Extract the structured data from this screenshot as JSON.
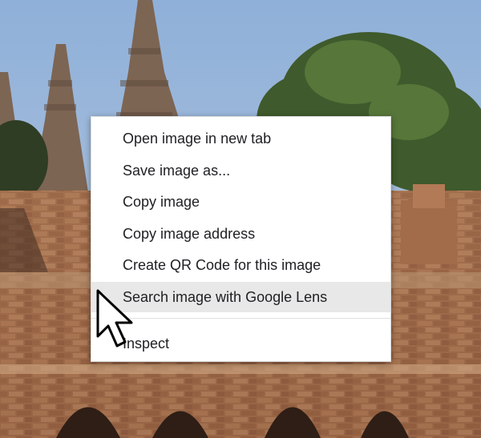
{
  "context_menu": {
    "items": [
      {
        "label": "Open image in new tab"
      },
      {
        "label": "Save image as..."
      },
      {
        "label": "Copy image"
      },
      {
        "label": "Copy image address"
      },
      {
        "label": "Create QR Code for this image"
      },
      {
        "label": "Search image with Google Lens",
        "highlighted": true
      },
      {
        "label": "Inspect"
      }
    ]
  },
  "colors": {
    "menu_background": "#ffffff",
    "highlight_background": "#e8e8e8",
    "text": "#202124"
  },
  "icons": {
    "pointer": "mouse-cursor-icon"
  }
}
